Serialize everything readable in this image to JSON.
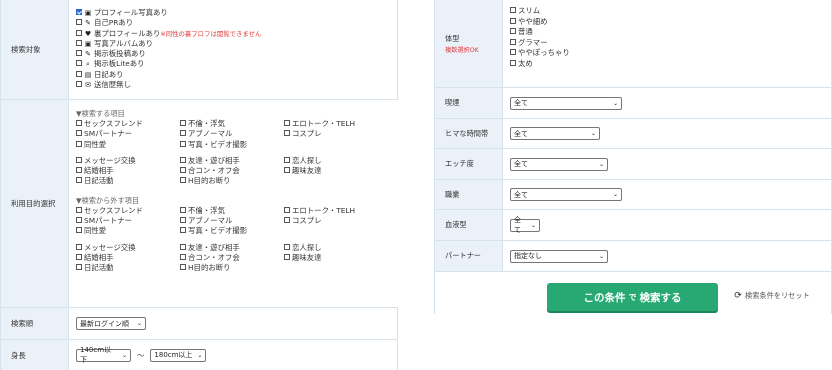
{
  "left": {
    "target": {
      "label": "検索対象",
      "options": [
        {
          "icon": "photo-icon",
          "glyph": "▣",
          "text": "プロフィール写真あり",
          "checked": true
        },
        {
          "icon": "pen-icon",
          "glyph": "✎",
          "text": "自己PRあり",
          "checked": false
        },
        {
          "icon": "heart-icon",
          "glyph": "♥",
          "text": "裏プロフィールあり",
          "note": "※同性の裏プロフは閲覧できません",
          "checked": false
        },
        {
          "icon": "album-icon",
          "glyph": "▣",
          "text": "写真アルバムあり",
          "checked": false
        },
        {
          "icon": "board-icon",
          "glyph": "✎",
          "text": "掲示板投稿あり",
          "checked": false
        },
        {
          "icon": "search-icon",
          "glyph": "⌕",
          "text": "掲示板Liteあり",
          "checked": false
        },
        {
          "icon": "diary-icon",
          "glyph": "▤",
          "text": "日記あり",
          "checked": false
        },
        {
          "icon": "mail-icon",
          "glyph": "✉",
          "text": "送信歴無し",
          "checked": false
        }
      ]
    },
    "purpose": {
      "label": "利用目的選択",
      "include_title": "▼検索する項目",
      "exclude_title": "▼検索から外す項目",
      "include_group1": [
        "セックスフレンド",
        "不倫・浮気",
        "エロトーク・TELH",
        "SMパートナー",
        "アブノーマル",
        "コスプレ",
        "同性愛",
        "写真・ビデオ撮影"
      ],
      "include_group2": [
        "メッセージ交換",
        "友達・遊び相手",
        "恋人探し",
        "結婚相手",
        "合コン・オフ会",
        "趣味友達",
        "日記活動",
        "H目的お断り"
      ],
      "exclude_group1": [
        "セックスフレンド",
        "不倫・浮気",
        "エロトーク・TELH",
        "SMパートナー",
        "アブノーマル",
        "コスプレ",
        "同性愛",
        "写真・ビデオ撮影"
      ],
      "exclude_group2": [
        "メッセージ交換",
        "友達・遊び相手",
        "恋人探し",
        "結婚相手",
        "合コン・オフ会",
        "趣味友達",
        "日記活動",
        "H目的お断り"
      ]
    },
    "order": {
      "label": "検索順",
      "value": "最新ログイン順"
    },
    "height": {
      "label": "身長",
      "min": "140cm以下",
      "tilde": "〜",
      "max": "180cm以上"
    }
  },
  "right": {
    "body_type": {
      "label": "体型",
      "sub": "複数選択OK",
      "options": [
        "スリム",
        "やや細め",
        "普通",
        "グラマー",
        "ややぽっちゃり",
        "太め"
      ]
    },
    "smoking": {
      "label": "喫煙",
      "value": "全て"
    },
    "free_time": {
      "label": "ヒマな時間帯",
      "value": "全て"
    },
    "ecchi": {
      "label": "エッチ度",
      "value": "全て"
    },
    "job": {
      "label": "職業",
      "value": "全て"
    },
    "blood": {
      "label": "血液型",
      "value": "全て"
    },
    "partner": {
      "label": "パートナー",
      "value": "指定なし"
    },
    "search_button": {
      "prefix": "この条件",
      "mid": "で",
      "suffix": "検索する"
    },
    "reset_label": "検索条件をリセット"
  }
}
